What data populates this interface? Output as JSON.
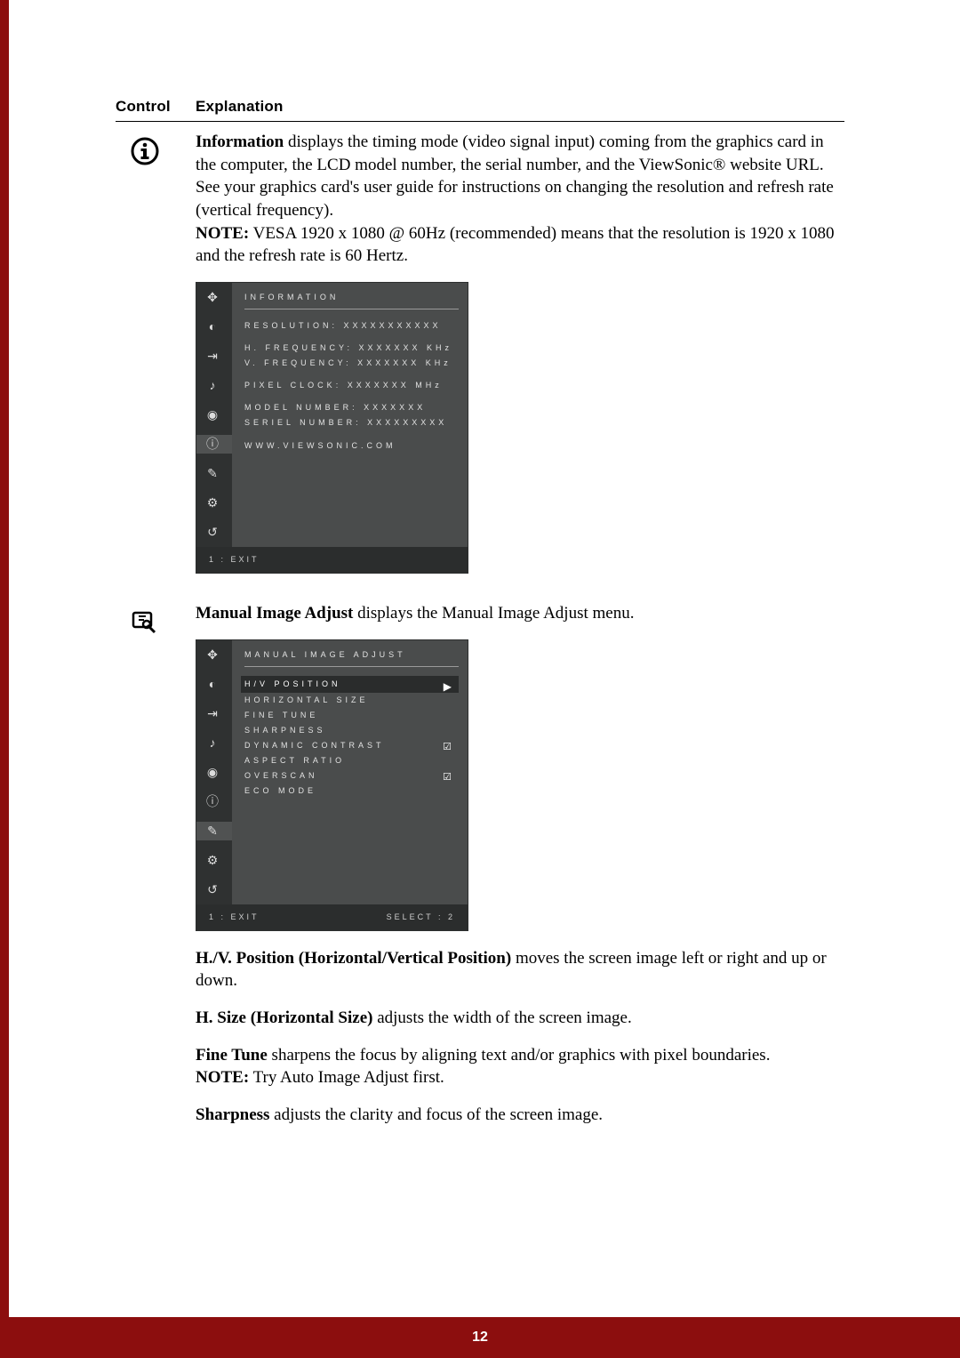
{
  "header": {
    "col1": "Control",
    "col2": "Explanation"
  },
  "info_section": {
    "bold_lead": "Information",
    "text_1": " displays the timing mode (video signal input) coming from the graphics card in the computer, the LCD model number, the serial number, and the ViewSonic",
    "reg_mark": "®",
    "text_2": " website URL. See your graphics card's user guide for instructions on changing the resolution and refresh rate (vertical frequency).",
    "note_label": "NOTE:",
    "note_text": " VESA 1920 x 1080 @ 60Hz (recommended) means that the resolution is 1920 x 1080 and the refresh rate is 60 Hertz."
  },
  "osd_info": {
    "title": "INFORMATION",
    "rows": [
      "RESOLUTION: XXXXXXXXXXX",
      "H. FREQUENCY: XXXXXXX KHz",
      "V. FREQUENCY: XXXXXXX KHz",
      "PIXEL CLOCK: XXXXXXX  MHz",
      "MODEL NUMBER: XXXXXXX",
      "SERIEL NUMBER: XXXXXXXXX",
      "WWW.VIEWSONIC.COM"
    ],
    "footer_left": "1 : EXIT"
  },
  "mia_intro": {
    "bold_lead": "Manual Image Adjust",
    "text": " displays the Manual Image Adjust menu."
  },
  "osd_mia": {
    "title": "MANUAL IMAGE ADJUST",
    "items": [
      {
        "label": "H/V POSITION",
        "selected": true,
        "arrow": true
      },
      {
        "label": "HORIZONTAL SIZE"
      },
      {
        "label": "FINE TUNE"
      },
      {
        "label": "SHARPNESS"
      },
      {
        "label": "DYNAMIC CONTRAST",
        "check": true
      },
      {
        "label": "ASPECT RATIO"
      },
      {
        "label": "OVERSCAN",
        "check": true
      },
      {
        "label": "ECO MODE"
      }
    ],
    "footer_left": "1 : EXIT",
    "footer_right": "SELECT : 2"
  },
  "hv_pos": {
    "bold_lead": "H./V. Position (Horizontal/Vertical Position)",
    "text": " moves the screen image left or right and up or down."
  },
  "hsize": {
    "bold_lead": "H. Size (Horizontal Size)",
    "text": " adjusts the width of the screen image."
  },
  "finetune": {
    "bold_lead": "Fine Tune",
    "text": " sharpens the focus by aligning text and/or graphics with pixel boundaries.",
    "note_label": "NOTE:",
    "note_text": " Try Auto Image Adjust first."
  },
  "sharpness": {
    "bold_lead": "Sharpness",
    "text": " adjusts the clarity and focus of the screen image."
  },
  "page_number": "12"
}
